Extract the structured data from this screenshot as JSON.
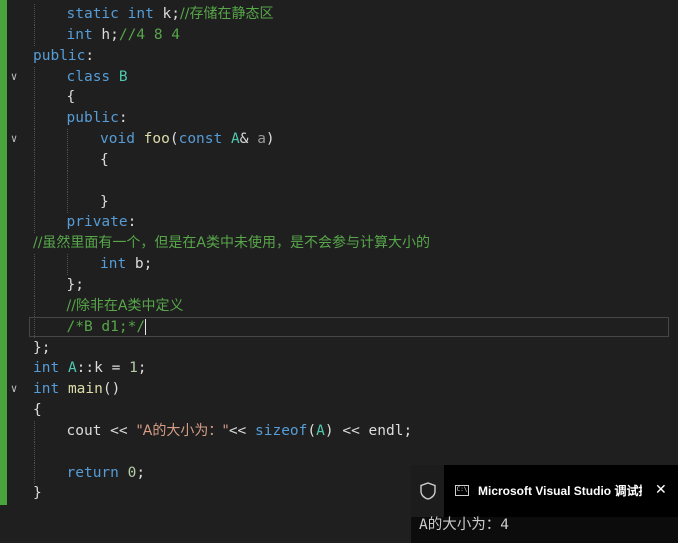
{
  "editor": {
    "lines": [
      {
        "indent": 1,
        "segments": [
          {
            "t": "static",
            "c": "kw"
          },
          {
            "t": " "
          },
          {
            "t": "int",
            "c": "kw"
          },
          {
            "t": " k;"
          },
          {
            "t": "//存储在静态区",
            "c": "cm"
          }
        ]
      },
      {
        "indent": 1,
        "segments": [
          {
            "t": "int",
            "c": "kw"
          },
          {
            "t": " h;"
          },
          {
            "t": "//4 8 4",
            "c": "cm"
          }
        ]
      },
      {
        "indent": 0,
        "segments": [
          {
            "t": "public",
            "c": "kw"
          },
          {
            "t": ":"
          }
        ]
      },
      {
        "indent": 1,
        "fold": true,
        "segments": [
          {
            "t": "class",
            "c": "kw"
          },
          {
            "t": " "
          },
          {
            "t": "B",
            "c": "ty"
          }
        ]
      },
      {
        "indent": 1,
        "segments": [
          {
            "t": "{"
          }
        ]
      },
      {
        "indent": 1,
        "segments": [
          {
            "t": "public",
            "c": "kw"
          },
          {
            "t": ":"
          }
        ]
      },
      {
        "indent": 2,
        "fold": true,
        "segments": [
          {
            "t": "void",
            "c": "kw"
          },
          {
            "t": " "
          },
          {
            "t": "foo",
            "c": "fn"
          },
          {
            "t": "("
          },
          {
            "t": "const",
            "c": "kw"
          },
          {
            "t": " "
          },
          {
            "t": "A",
            "c": "ty"
          },
          {
            "t": "& "
          },
          {
            "t": "a",
            "c": "pm"
          },
          {
            "t": ")"
          }
        ]
      },
      {
        "indent": 2,
        "segments": [
          {
            "t": "{"
          }
        ]
      },
      {
        "indent": 2,
        "segments": []
      },
      {
        "indent": 2,
        "segments": [
          {
            "t": "}"
          }
        ]
      },
      {
        "indent": 1,
        "segments": [
          {
            "t": "private",
            "c": "kw"
          },
          {
            "t": ":"
          }
        ]
      },
      {
        "indent": 0,
        "segments": [
          {
            "t": "//虽然里面有一个，但是在A类中未使用，是不会参与计算大小的",
            "c": "cm"
          }
        ]
      },
      {
        "indent": 2,
        "segments": [
          {
            "t": "int",
            "c": "kw"
          },
          {
            "t": " b;"
          }
        ]
      },
      {
        "indent": 1,
        "segments": [
          {
            "t": "};"
          }
        ]
      },
      {
        "indent": 1,
        "segments": [
          {
            "t": "//除非在A类中定义",
            "c": "cm"
          }
        ]
      },
      {
        "indent": 1,
        "cursor": true,
        "segments": [
          {
            "t": "/*B d1;*/",
            "c": "cm"
          }
        ]
      },
      {
        "indent": 0,
        "segments": [
          {
            "t": "};"
          }
        ]
      },
      {
        "indent": 0,
        "segments": [
          {
            "t": "int",
            "c": "kw"
          },
          {
            "t": " "
          },
          {
            "t": "A",
            "c": "ty"
          },
          {
            "t": "::k = "
          },
          {
            "t": "1",
            "c": "nm"
          },
          {
            "t": ";"
          }
        ]
      },
      {
        "indent": 0,
        "fold": true,
        "segments": [
          {
            "t": "int",
            "c": "kw"
          },
          {
            "t": " "
          },
          {
            "t": "main",
            "c": "fn"
          },
          {
            "t": "()"
          }
        ]
      },
      {
        "indent": 0,
        "segments": [
          {
            "t": "{"
          }
        ]
      },
      {
        "indent": 1,
        "segments": [
          {
            "t": "cout"
          },
          {
            "t": " << "
          },
          {
            "t": "\"A的大小为：\"",
            "c": "st"
          },
          {
            "t": "<< "
          },
          {
            "t": "sizeof",
            "c": "kw"
          },
          {
            "t": "("
          },
          {
            "t": "A",
            "c": "ty"
          },
          {
            "t": ") << endl;"
          }
        ]
      },
      {
        "indent": 1,
        "segments": []
      },
      {
        "indent": 1,
        "segments": [
          {
            "t": "return",
            "c": "kw"
          },
          {
            "t": " "
          },
          {
            "t": "0",
            "c": "nm"
          },
          {
            "t": ";"
          }
        ]
      },
      {
        "indent": 0,
        "segments": [
          {
            "t": "}"
          }
        ]
      }
    ]
  },
  "console": {
    "title": "Microsoft Visual Studio 调试控制台",
    "app_icon_text": "C:\\",
    "close_glyph": "✕",
    "output": "A的大小为：4"
  },
  "colors": {
    "background": "#1f1f1f",
    "keyword": "#569cd6",
    "type": "#4ec9b0",
    "function": "#dcdcaa",
    "comment": "#57a64a",
    "string": "#d69d85",
    "number": "#b5cea8",
    "change_bar": "#4aa43e"
  }
}
